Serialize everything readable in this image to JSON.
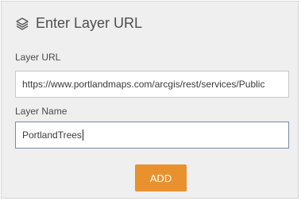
{
  "header": {
    "title": "Enter Layer URL",
    "icon": "layers-icon"
  },
  "form": {
    "layer_url": {
      "label": "Layer URL",
      "value": "https://www.portlandmaps.com/arcgis/rest/services/Public"
    },
    "layer_name": {
      "label": "Layer Name",
      "value": "PortlandTrees"
    }
  },
  "actions": {
    "add_label": "ADD"
  },
  "colors": {
    "accent": "#e8912e",
    "panel_bg": "#efefef"
  }
}
